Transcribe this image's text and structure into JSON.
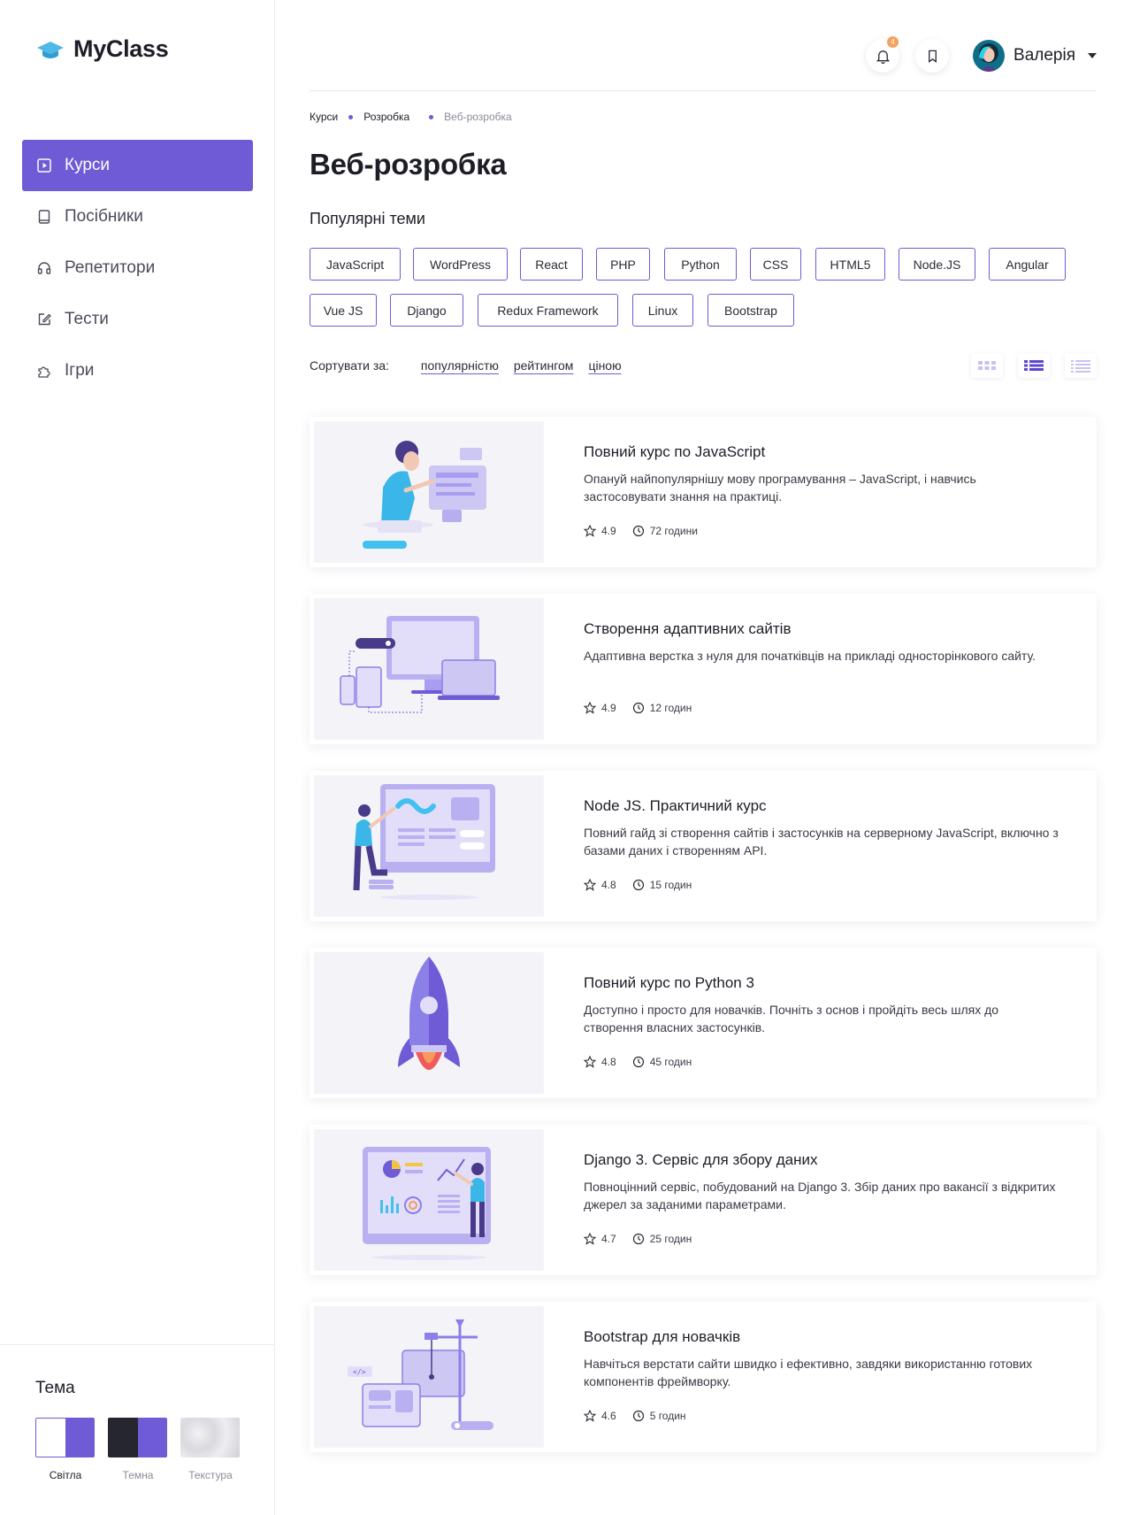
{
  "app": {
    "name": "MyClass"
  },
  "colors": {
    "accent": "#6e5bd5",
    "logo": "#4fb8e7",
    "badge": "#f5a25d",
    "page_bg": "#ffffff",
    "card_img_bg": "#f4f4f8"
  },
  "sidebar": {
    "items": [
      {
        "label": "Курси",
        "icon": "play-square-icon",
        "active": true
      },
      {
        "label": "Посібники",
        "icon": "book-icon",
        "active": false
      },
      {
        "label": "Репетитори",
        "icon": "headphones-icon",
        "active": false
      },
      {
        "label": "Тести",
        "icon": "edit-icon",
        "active": false
      },
      {
        "label": "Ігри",
        "icon": "puzzle-icon",
        "active": false
      }
    ]
  },
  "theme": {
    "title": "Тема",
    "options": [
      {
        "label": "Світла",
        "selected": true
      },
      {
        "label": "Темна",
        "selected": false
      },
      {
        "label": "Текстура",
        "selected": false
      }
    ]
  },
  "header": {
    "notifications_count": "4",
    "user_name": "Валерія"
  },
  "breadcrumb": [
    "Курси",
    "Розробка",
    "Веб-розробка"
  ],
  "page_title": "Веб-розробка",
  "topics": {
    "title": "Популярні теми",
    "tags": [
      "JavaScript",
      "WordPress",
      "React",
      "PHP",
      "Python",
      "CSS",
      "HTML5",
      "Node.JS",
      "Angular",
      "Vue JS",
      "Django",
      "Redux Framework",
      "Linux",
      "Bootstrap"
    ]
  },
  "sort": {
    "label": "Сортувати за:",
    "options": [
      "популярністю",
      "рейтингом",
      "ціною"
    ]
  },
  "view_modes": [
    "grid-view-icon",
    "list-view-icon",
    "compact-list-view-icon"
  ],
  "active_view": "list-view-icon",
  "courses": [
    {
      "title": "Повний курс по JavaScript",
      "desc": "Опануй найпопулярнішу мову програмування – JavaScript, і навчись застосовувати знання на практиці.",
      "rating": "4.9",
      "duration": "72 години"
    },
    {
      "title": "Створення адаптивних сайтів",
      "desc": "Адаптивна верстка з нуля для початківців на прикладі односторінкового сайту.",
      "rating": "4.9",
      "duration": "12 годин"
    },
    {
      "title": "Node JS. Практичний курс",
      "desc": "Повний гайд зі створення сайтів і застосунків на серверному JavaScript, включно з базами даних і створенням API.",
      "rating": "4.8",
      "duration": "15 годин"
    },
    {
      "title": "Повний курс по Python 3",
      "desc": "Доступно і просто для новачків. Почніть з основ і пройдіть весь шлях до створення власних застосунків.",
      "rating": "4.8",
      "duration": "45 годин"
    },
    {
      "title": "Django 3. Сервіс для збору даних",
      "desc": "Повноцінний сервіс, побудований на Django 3. Збір даних про вакансії з відкритих джерел за заданими параметрами.",
      "rating": "4.7",
      "duration": "25 годин"
    },
    {
      "title": "Bootstrap для новачків",
      "desc": "Навчіться верстати сайти швидко і ефективно, завдяки використанню готових компонентів фреймворку.",
      "rating": "4.6",
      "duration": "5 годин"
    }
  ]
}
